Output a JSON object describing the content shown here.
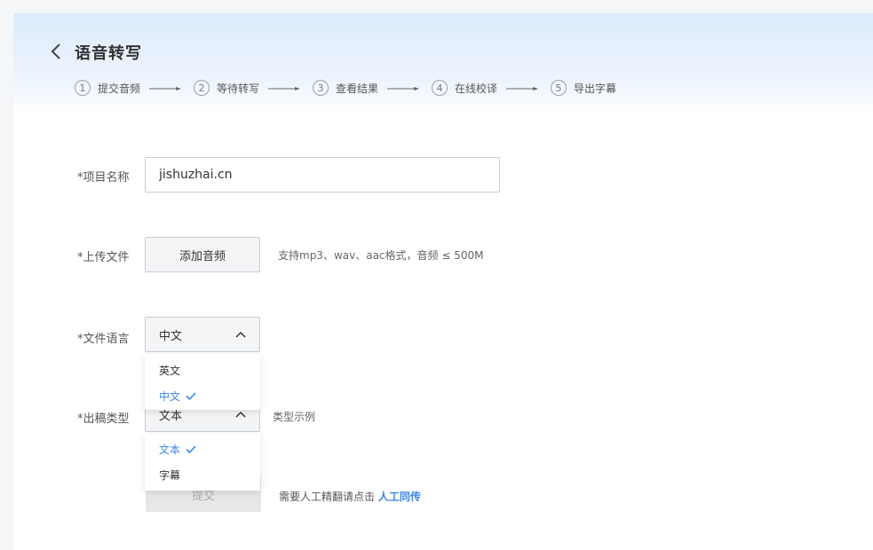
{
  "header": {
    "title": "语音转写",
    "steps": [
      {
        "num": "1",
        "label": "提交音频"
      },
      {
        "num": "2",
        "label": "等待转写"
      },
      {
        "num": "3",
        "label": "查看结果"
      },
      {
        "num": "4",
        "label": "在线校译"
      },
      {
        "num": "5",
        "label": "导出字幕"
      }
    ]
  },
  "form": {
    "project_name": {
      "label": "*项目名称",
      "value": "jishuzhai.cn"
    },
    "upload": {
      "label": "*上传文件",
      "button": "添加音频",
      "hint": "支持mp3、wav、aac格式，音频 ≤ 500M"
    },
    "language": {
      "label": "*文件语言",
      "selected": "中文",
      "options": [
        {
          "label": "英文",
          "selected": false
        },
        {
          "label": "中文",
          "selected": true
        }
      ]
    },
    "output_type": {
      "label": "*出稿类型",
      "selected": "文本",
      "hint": "类型示例",
      "options": [
        {
          "label": "文本",
          "selected": true
        },
        {
          "label": "字幕",
          "selected": false
        }
      ]
    },
    "submit": {
      "label": "提交"
    },
    "manual": {
      "text": "需要人工精翻请点击",
      "link": "人工同传"
    }
  },
  "colors": {
    "accent": "#3d86e0",
    "header_gradient_top": "#dcebfc",
    "background": "#f5f6f7"
  },
  "icons": {
    "back": "chevron-left-icon",
    "step_arrow": "arrow-right-icon",
    "select": "chevron-up-icon",
    "check": "check-icon"
  }
}
